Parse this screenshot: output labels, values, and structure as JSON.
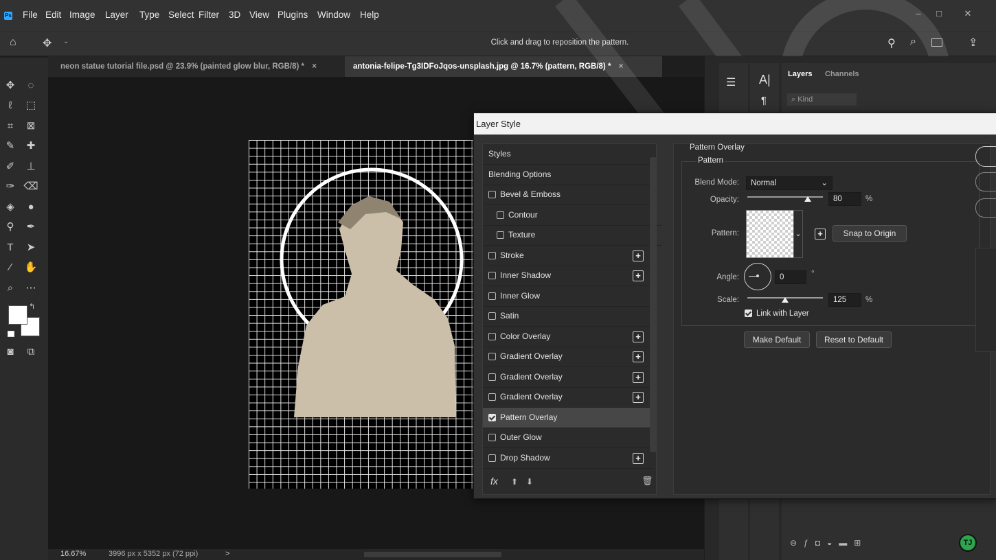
{
  "app": {
    "logo": "Ps",
    "menu": [
      "File",
      "Edit",
      "Image",
      "Layer",
      "Type",
      "Select",
      "Filter",
      "3D",
      "View",
      "Plugins",
      "Window",
      "Help"
    ]
  },
  "options_bar": {
    "hint": "Click and drag to reposition the pattern."
  },
  "tabs": [
    {
      "label": "neon statue tutorial file.psd @ 23.9% (painted glow blur, RGB/8) *",
      "close": "×"
    },
    {
      "label": "antonia-felipe-Tg3IDFoJqos-unsplash.jpg @ 16.7% (pattern, RGB/8) *",
      "close": "×"
    }
  ],
  "status": {
    "zoom": "16.67%",
    "dimensions": "3996 px x 5352 px (72 ppi)",
    "arrow": ">"
  },
  "right_panel": {
    "tabs": [
      "Layers",
      "Channels"
    ],
    "filter_placeholder": "Kind"
  },
  "dialog": {
    "title": "Layer Style",
    "styles_list": [
      {
        "label": "Styles",
        "checkbox": false,
        "plus": false,
        "indent": false
      },
      {
        "label": "Blending Options",
        "checkbox": false,
        "plus": false,
        "indent": false
      },
      {
        "label": "Bevel & Emboss",
        "checkbox": true,
        "checked": false,
        "plus": false,
        "indent": false
      },
      {
        "label": "Contour",
        "checkbox": true,
        "checked": false,
        "plus": false,
        "indent": true
      },
      {
        "label": "Texture",
        "checkbox": true,
        "checked": false,
        "plus": false,
        "indent": true
      },
      {
        "label": "Stroke",
        "checkbox": true,
        "checked": false,
        "plus": true,
        "indent": false
      },
      {
        "label": "Inner Shadow",
        "checkbox": true,
        "checked": false,
        "plus": true,
        "indent": false
      },
      {
        "label": "Inner Glow",
        "checkbox": true,
        "checked": false,
        "plus": false,
        "indent": false
      },
      {
        "label": "Satin",
        "checkbox": true,
        "checked": false,
        "plus": false,
        "indent": false
      },
      {
        "label": "Color Overlay",
        "checkbox": true,
        "checked": false,
        "plus": true,
        "indent": false
      },
      {
        "label": "Gradient Overlay",
        "checkbox": true,
        "checked": false,
        "plus": true,
        "indent": false
      },
      {
        "label": "Gradient Overlay",
        "checkbox": true,
        "checked": false,
        "plus": true,
        "indent": false
      },
      {
        "label": "Gradient Overlay",
        "checkbox": true,
        "checked": false,
        "plus": true,
        "indent": false
      },
      {
        "label": "Pattern Overlay",
        "checkbox": true,
        "checked": true,
        "plus": false,
        "indent": false,
        "selected": true
      },
      {
        "label": "Outer Glow",
        "checkbox": true,
        "checked": false,
        "plus": false,
        "indent": false
      },
      {
        "label": "Drop Shadow",
        "checkbox": true,
        "checked": false,
        "plus": true,
        "indent": false
      }
    ],
    "footer_fx": "fx",
    "section_title": "Pattern Overlay",
    "group_title": "Pattern",
    "blend_mode_label": "Blend Mode:",
    "blend_mode_value": "Normal",
    "opacity_label": "Opacity:",
    "opacity_value": "80",
    "opacity_unit": "%",
    "opacity_level": 0.8,
    "pattern_label": "Pattern:",
    "snap_button": "Snap to Origin",
    "angle_label": "Angle:",
    "angle_value": "0",
    "angle_unit": "°",
    "scale_label": "Scale:",
    "scale_value": "125",
    "scale_unit": "%",
    "link_label": "Link with Layer",
    "link_checked": true,
    "make_default": "Make Default",
    "reset_default": "Reset to Default"
  },
  "colors": {
    "accent": "#31a8ff",
    "selection": "#474747",
    "badge": "#2da44e"
  }
}
